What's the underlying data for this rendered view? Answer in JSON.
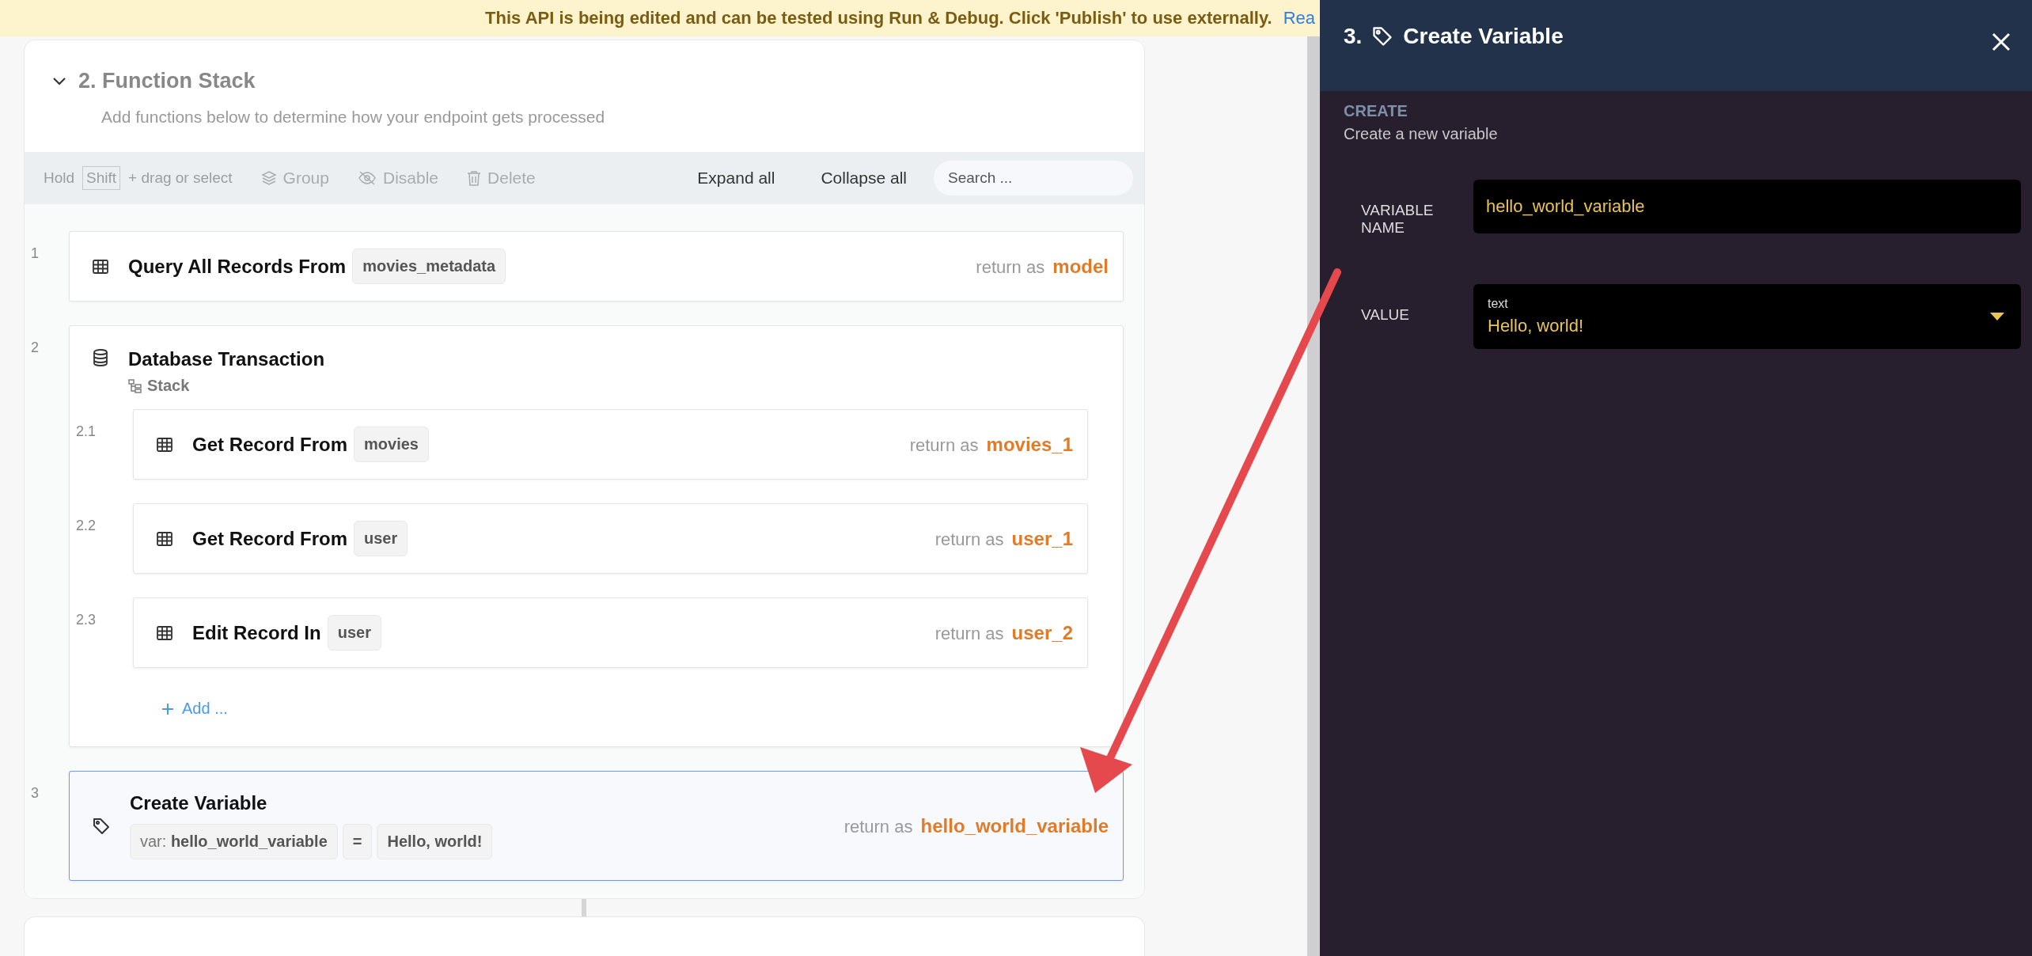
{
  "banner": {
    "text": "This API is being edited and can be tested using Run & Debug. Click 'Publish' to use externally.",
    "link": "Rea"
  },
  "section": {
    "title": "2. Function Stack",
    "subtitle": "Add functions below to determine how your endpoint gets processed",
    "expanded": true
  },
  "toolbar": {
    "hold": "Hold",
    "key": "Shift",
    "hint": "+ drag or select",
    "actions": [
      {
        "kind": "group",
        "label": "Group",
        "disabled": true
      },
      {
        "kind": "disable",
        "label": "Disable",
        "disabled": true
      },
      {
        "kind": "delete",
        "label": "Delete",
        "disabled": true
      }
    ],
    "expand": "Expand all",
    "collapse": "Collapse all",
    "search": {
      "placeholder": "Search ..."
    }
  },
  "steps": [
    {
      "number": "1",
      "kind": "table",
      "title": "Query All Records From",
      "tag": "movies_metadata",
      "return_label": "return as",
      "return_name": "model",
      "selected": false
    },
    {
      "number": "2",
      "kind": "transaction",
      "title": "Database Transaction",
      "subtitle": "Stack",
      "selected": false,
      "add": "Add ...",
      "children": [
        {
          "number": "2.1",
          "kind": "table",
          "title": "Get Record From",
          "tag": "movies",
          "return_label": "return as",
          "return_name": "movies_1",
          "selected": false
        },
        {
          "number": "2.2",
          "kind": "table",
          "title": "Get Record From",
          "tag": "user",
          "return_label": "return as",
          "return_name": "user_1",
          "selected": false
        },
        {
          "number": "2.3",
          "kind": "table",
          "title": "Edit Record In",
          "tag": "user",
          "return_label": "return as",
          "return_name": "user_2",
          "selected": false
        }
      ]
    },
    {
      "number": "3",
      "kind": "variable",
      "title": "Create Variable",
      "selected": true,
      "return_label": "return as",
      "return_name": "hello_world_variable",
      "params": [
        {
          "prefix": "var:",
          "value": "hello_world_variable"
        },
        {
          "value": "="
        },
        {
          "value": "Hello, world!"
        }
      ]
    }
  ],
  "panel": {
    "number": "3.",
    "title": "Create Variable",
    "section_label": "CREATE",
    "section_desc": "Create a new variable",
    "fields": [
      {
        "kind": "input",
        "label": "VARIABLE NAME",
        "value": "hello_world_variable"
      },
      {
        "kind": "select",
        "label": "VALUE",
        "type_label": "text",
        "value": "Hello, world!"
      }
    ]
  }
}
